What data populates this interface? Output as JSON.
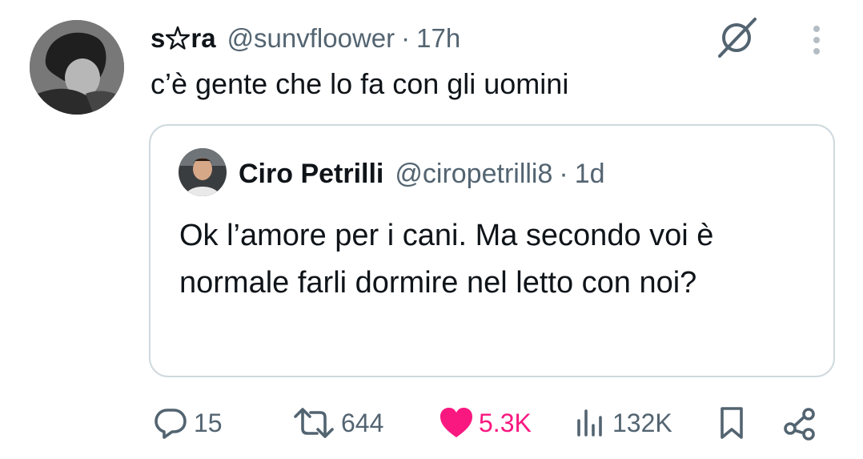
{
  "tweet": {
    "display_name_pre": "s",
    "display_name_post": "ra",
    "handle": "@sunvfloower",
    "separator": "·",
    "time": "17h",
    "text": "c’è gente che lo fa con gli uomini"
  },
  "quote": {
    "display_name": "Ciro Petrilli",
    "handle": "@ciropetrilli8",
    "separator": "·",
    "time": "1d",
    "text": "Ok l’amore per i cani. Ma secondo voi è normale farli dormire nel letto con noi?"
  },
  "actions": {
    "replies": "15",
    "retweets": "644",
    "likes": "5.3K",
    "views": "132K"
  },
  "icons": {
    "display_name_symbol": "pentagram-icon",
    "top_right_1": "grok-icon",
    "top_right_2": "more-icon",
    "reply": "reply-icon",
    "retweet": "retweet-icon",
    "like": "heart-filled-icon",
    "views": "views-icon",
    "bookmark": "bookmark-icon",
    "share": "share-icon"
  },
  "colors": {
    "text": "#0f1419",
    "secondary": "#536471",
    "like": "#f91880",
    "border": "#cfd9de"
  }
}
